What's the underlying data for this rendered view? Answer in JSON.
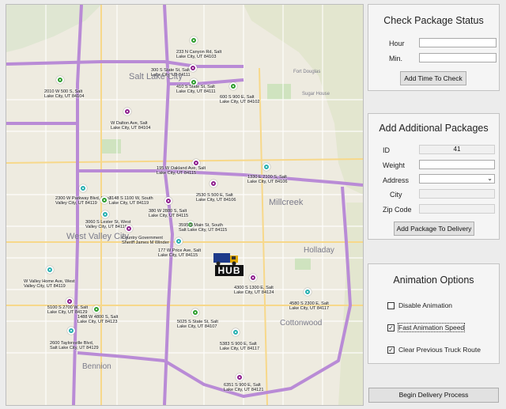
{
  "check_status": {
    "title": "Check Package Status",
    "hour_label": "Hour",
    "hour_value": "",
    "min_label": "Min.",
    "min_value": "",
    "button": "Add Time To Check"
  },
  "add_packages": {
    "title": "Add Additional Packages",
    "id_label": "ID",
    "id_value": "41",
    "weight_label": "Weight",
    "address_label": "Address",
    "city_label": "City",
    "zip_label": "Zip Code",
    "button": "Add Package To Delivery"
  },
  "animation": {
    "title": "Animation Options",
    "options": [
      {
        "label": "Disable Animation",
        "checked": false
      },
      {
        "label": "Fast Animation Speed",
        "checked": true
      },
      {
        "label": "Clear Previous Truck Route",
        "checked": true
      }
    ]
  },
  "begin_button": "Begin Delivery Process",
  "map": {
    "hub_label": "HUB",
    "areas": [
      "Salt Lake City",
      "West Valley City",
      "Millcreek",
      "Bennion",
      "Holladay",
      "Cottonwood",
      "Fort Douglas",
      "Sugar House"
    ],
    "markers": [
      {
        "color": "#2e9e2e",
        "label": [
          "233 N Canyon Rd, Salt",
          "Lake City, UT 84103"
        ]
      },
      {
        "color": "#8e1f8e",
        "label": [
          "300 S State St, Salt",
          "Lake City, UT 84111"
        ]
      },
      {
        "color": "#2e9e2e",
        "label": [
          "410 S State St, Salt",
          "Lake City, UT 84111"
        ]
      },
      {
        "color": "#2e9e2e",
        "label": [
          "600 S 900 E, Salt",
          "Lake City, UT 84102"
        ]
      },
      {
        "color": "#2e9e2e",
        "label": [
          "2010 W 500 S, Salt",
          "Lake City, UT 84104"
        ]
      },
      {
        "color": "#8e1f8e",
        "label": [
          "W Dalton Ave, Salt",
          "Lake City, UT 84104"
        ]
      },
      {
        "color": "#8e1f8e",
        "label": [
          "195 W Oakland Ave, Salt",
          "Lake City, UT 84115"
        ]
      },
      {
        "color": "#27b0b0",
        "label": [
          "1330 E 2100 S, Salt",
          "Lake City, UT 84106"
        ]
      },
      {
        "color": "#27b0b0",
        "label": [
          "2300 W Parkway Blvd, West",
          "Valley City, UT 84119"
        ]
      },
      {
        "color": "#2e9e2e",
        "label": [
          "3148 S 1100 W, South",
          "Lake City, UT 84119"
        ]
      },
      {
        "color": "#8e1f8e",
        "label": [
          "2530 S 500 E, Salt",
          "Lake City, UT 84106"
        ]
      },
      {
        "color": "#8e1f8e",
        "label": [
          "380 W 2880 S, Salt",
          "Lake City, UT 84115"
        ]
      },
      {
        "color": "#27b0b0",
        "label": [
          "3060 S Lester St, West",
          "Valley City, UT 84119"
        ]
      },
      {
        "color": "#8e1f8e",
        "label": [
          "Country Government",
          "Sheriff James M Winder"
        ]
      },
      {
        "color": "#2e9e2e",
        "label": [
          "3595 S Main St, South",
          "Salt Lake City, UT 84115"
        ]
      },
      {
        "color": "#27b0b0",
        "label": [
          "177 W Price Ave, Salt",
          "Lake City, UT 84115"
        ]
      },
      {
        "color": "#27b0b0",
        "label": [
          "W Valley Home Ave, West",
          "Valley City, UT 84119"
        ]
      },
      {
        "color": "#8e1f8e",
        "label": [
          "4300 S 1300 E, Salt",
          "Lake City, UT 84124"
        ]
      },
      {
        "color": "#27b0b0",
        "label": [
          "4580 S 2300 E, Salt",
          "Lake City, UT 84117"
        ]
      },
      {
        "color": "#8e1f8e",
        "label": [
          "5100 S 2700 W, Salt",
          "Lake City, UT 84129"
        ]
      },
      {
        "color": "#2e9e2e",
        "label": [
          "1488 W 4800 S, Salt",
          "Lake City, UT 84123"
        ]
      },
      {
        "color": "#2e9e2e",
        "label": [
          "5025 S State St, Salt",
          "Lake City, UT 84107"
        ]
      },
      {
        "color": "#27b0b0",
        "label": [
          "2600 Taylorsville Blvd,",
          "Salt Lake City, UT 84129"
        ]
      },
      {
        "color": "#27b0b0",
        "label": [
          "5383 S 900 E, Salt",
          "Lake City, UT 84117"
        ]
      },
      {
        "color": "#8e1f8e",
        "label": [
          "6351 S 900 E, Salt",
          "Lake City, UT 84121"
        ]
      }
    ]
  }
}
